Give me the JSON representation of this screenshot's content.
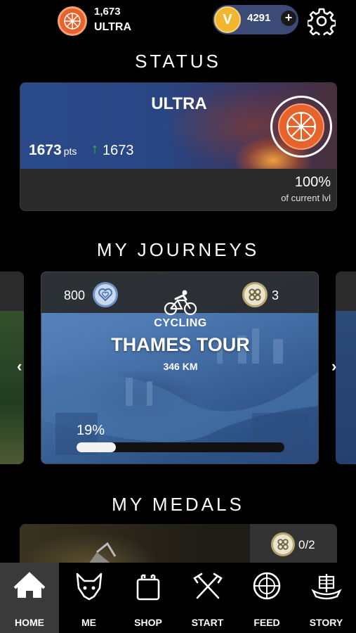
{
  "header": {
    "rank_points": "1,673",
    "rank_name": "ULTRA",
    "currency_value": "4291",
    "currency_symbol": "V",
    "add_symbol": "+"
  },
  "status": {
    "title": "STATUS",
    "level_name": "ULTRA",
    "points": "1673",
    "points_unit": "pts",
    "gain_arrow": "↑",
    "gain": "1673",
    "level_progress": "100%",
    "level_progress_label": "of current lvl"
  },
  "journeys": {
    "title": "MY JOURNEYS",
    "prev_arrow": "‹",
    "next_arrow": "›",
    "current": {
      "hearts": "800",
      "knots": "3",
      "type": "CYCLING",
      "name": "THAMES TOUR",
      "distance": "346 KM",
      "progress_label": "19%",
      "progress_fraction": 0.19
    }
  },
  "medals": {
    "title": "MY MEDALS",
    "count": "0/2"
  },
  "nav": {
    "items": [
      {
        "label": "HOME",
        "icon": "home-icon",
        "active": true
      },
      {
        "label": "ME",
        "icon": "wolf-head-icon",
        "active": false
      },
      {
        "label": "SHOP",
        "icon": "shop-bag-icon",
        "active": false
      },
      {
        "label": "START",
        "icon": "crossed-axes-icon",
        "active": false
      },
      {
        "label": "FEED",
        "icon": "round-shield-icon",
        "active": false
      },
      {
        "label": "STORY",
        "icon": "viking-ship-icon",
        "active": false
      }
    ]
  },
  "colors": {
    "accent_orange": "#e8622b",
    "coin_gold": "#f2b52f",
    "currency_bg": "#3c4a78",
    "progress_green": "#3fbf3f"
  }
}
